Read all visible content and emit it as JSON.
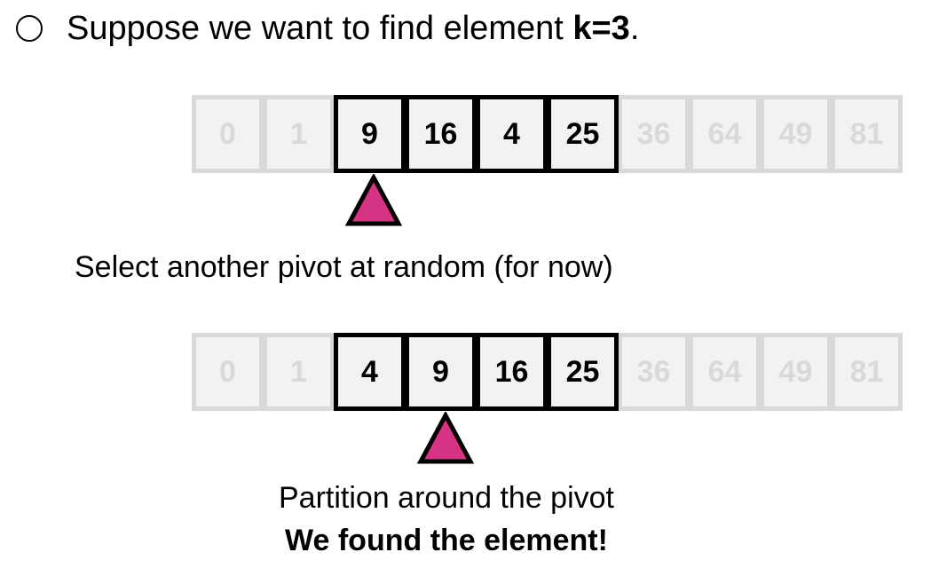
{
  "headline": {
    "prefix": "Suppose we want to find element ",
    "k_label": "k=3",
    "suffix": "."
  },
  "array_before": {
    "cells": [
      "0",
      "1",
      "9",
      "16",
      "4",
      "25",
      "36",
      "64",
      "49",
      "81"
    ],
    "active_range": [
      2,
      5
    ],
    "pivot_index": 2
  },
  "step_caption": "Select another pivot at random (for now)",
  "array_after": {
    "cells": [
      "0",
      "1",
      "4",
      "9",
      "16",
      "25",
      "36",
      "64",
      "49",
      "81"
    ],
    "active_range": [
      2,
      5
    ],
    "pivot_index": 3
  },
  "result_caption": "Partition around the pivot",
  "found_caption": "We found the element!",
  "colors": {
    "pivot_fill": "#d63384",
    "inactive_text": "#d9d9d9",
    "inactive_border": "#d9d9d9",
    "cell_fill": "#f2f2f2",
    "active_border": "#000000"
  }
}
